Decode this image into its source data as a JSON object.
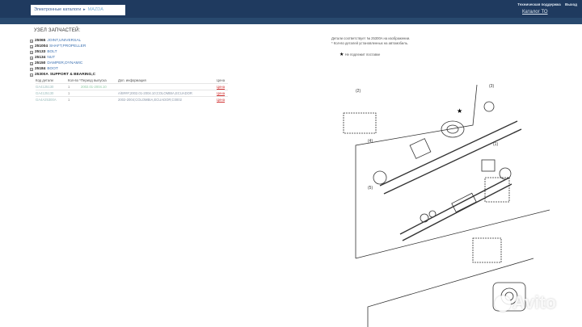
{
  "header": {
    "breadcrumb": [
      "Электронные каталоги",
      "MAZDA"
    ],
    "support": "Техническая поддержка",
    "logout": "Выход",
    "catalog_link": "Каталог ТО"
  },
  "section_title": "УЗЕЛ ЗАПЧАСТЕЙ:",
  "tree": [
    {
      "code": "25065",
      "name": "JOINT,UNIVERSAL"
    },
    {
      "code": "251004",
      "name": "SHAFT,PROPELLER"
    },
    {
      "code": "25133",
      "name": "BOLT"
    },
    {
      "code": "25134",
      "name": "NUT"
    },
    {
      "code": "25150",
      "name": "DAMPER,DYNAMIC"
    },
    {
      "code": "25184",
      "name": "BOOT"
    },
    {
      "code": "25300A",
      "name": "SUPPORT & BEARING,C"
    }
  ],
  "table": {
    "headers": [
      "Код детали",
      "Кол-во *",
      "Период выпуска",
      "Доп. информация",
      "Цена"
    ],
    "rows": [
      {
        "part": "GA4125130",
        "qty": "1",
        "period": "2002.01-2004.10",
        "info": "",
        "price": "Цена"
      },
      {
        "part": "GA4125130",
        "qty": "1",
        "period": "",
        "info": "A/B###;2002.01-2004.10;COLOMBIA,ECUADOR",
        "price": "Цена"
      },
      {
        "part": "GA4A25300A",
        "qty": "1",
        "period": "",
        "info": "2002-2004;COLOMBIA,ECUADOR;C0002",
        "price": "Цена"
      }
    ]
  },
  "notes": [
    "Детали соответствует № 25300A на изображении.",
    "* Кол-во деталей установленных на автомобиль."
  ],
  "legend_text": "Не подлежит поставке",
  "diagram_labels": [
    "(2)",
    "(4)",
    "(5)",
    "(1)",
    "(3)"
  ],
  "watermark": "Avito"
}
